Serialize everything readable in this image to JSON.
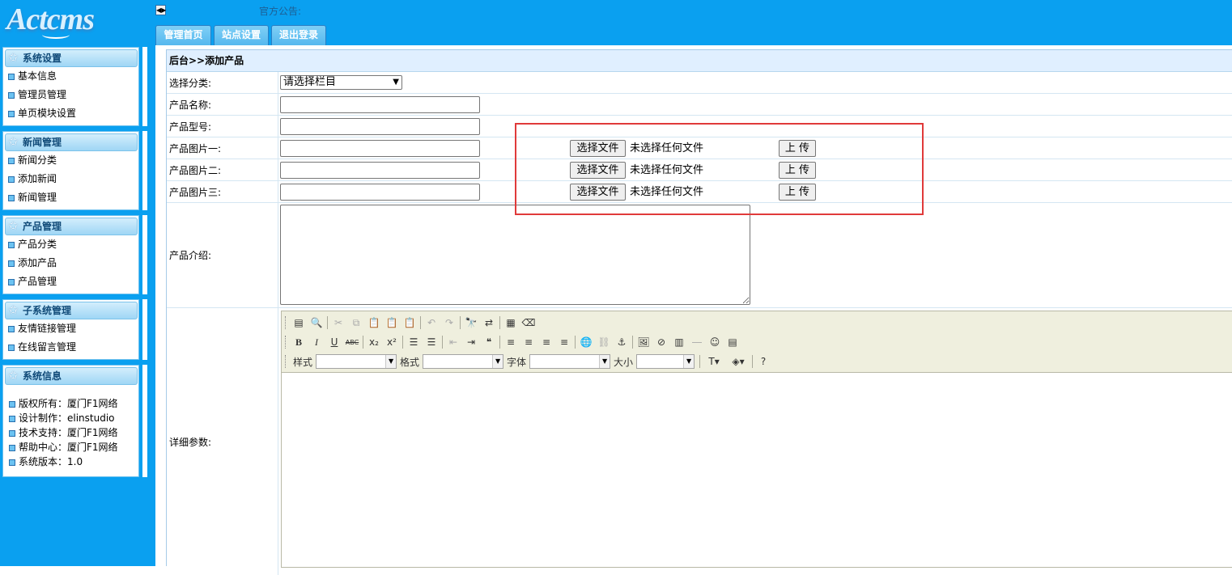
{
  "header": {
    "logo_text": "Actcms",
    "notice_label": "官方公告:",
    "tabs": [
      "管理首页",
      "站点设置",
      "退出登录"
    ]
  },
  "sidebar": {
    "system_settings": {
      "title": "系统设置",
      "items": [
        "基本信息",
        "管理员管理",
        "单页模块设置"
      ]
    },
    "news": {
      "title": "新闻管理",
      "items": [
        "新闻分类",
        "添加新闻",
        "新闻管理"
      ]
    },
    "products": {
      "title": "产品管理",
      "items": [
        "产品分类",
        "添加产品",
        "产品管理"
      ]
    },
    "subsystems": {
      "title": "子系统管理",
      "items": [
        "友情链接管理",
        "在线留言管理"
      ]
    },
    "system_info": {
      "title": "系统信息",
      "items": [
        "版权所有：厦门F1网络",
        "设计制作：elinstudio",
        "技术支持：厦门F1网络",
        "帮助中心：厦门F1网络",
        "系统版本：1.0"
      ]
    }
  },
  "main": {
    "breadcrumb": "后台>>添加产品",
    "category_label": "选择分类:",
    "category_selected": "请选择栏目",
    "name_label": "产品名称:",
    "model_label": "产品型号:",
    "image_labels": [
      "产品图片一:",
      "产品图片二:",
      "产品图片三:"
    ],
    "choose_file": "选择文件",
    "no_file": "未选择任何文件",
    "upload": "上 传",
    "intro_label": "产品介绍:",
    "params_label": "详细参数:"
  },
  "editor": {
    "style_label": "样式",
    "format_label": "格式",
    "font_label": "字体",
    "size_label": "大小"
  },
  "colors": {
    "accent": "#0aa0f0",
    "highlight": "#e03a3a"
  }
}
